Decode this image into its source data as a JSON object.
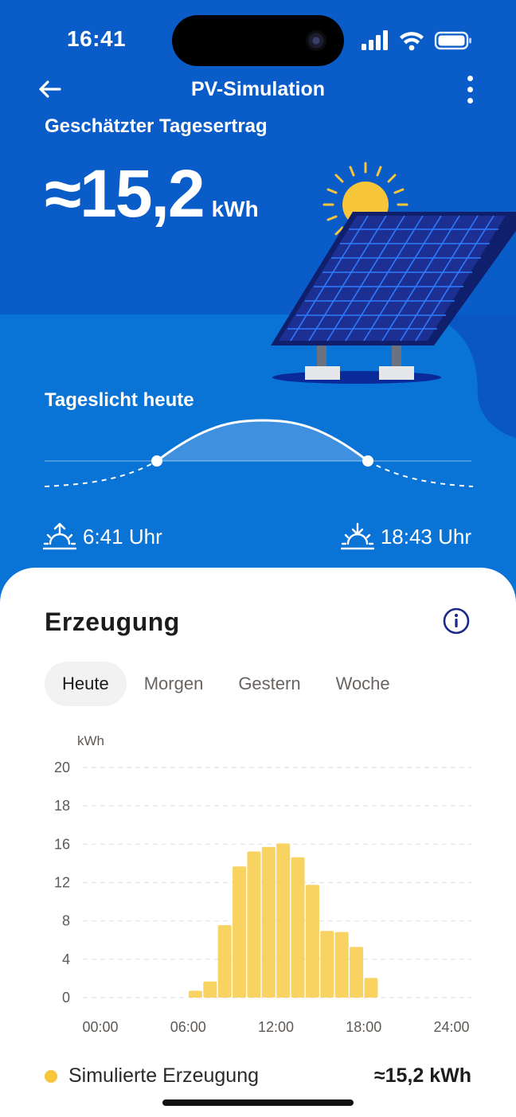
{
  "status_bar": {
    "time": "16:41"
  },
  "nav": {
    "title": "PV-Simulation",
    "back_icon": "arrow-left-icon",
    "menu_icon": "more-vertical-icon"
  },
  "hero": {
    "yield_label": "Geschätzter Tagesertrag",
    "yield_value": "≈15,2",
    "yield_unit": "kWh",
    "daylight_label": "Tageslicht heute",
    "sunrise": "6:41 Uhr",
    "sunset": "18:43 Uhr"
  },
  "sheet": {
    "title": "Erzeugung",
    "tabs": [
      {
        "label": "Heute",
        "active": true
      },
      {
        "label": "Morgen",
        "active": false
      },
      {
        "label": "Gestern",
        "active": false
      },
      {
        "label": "Woche",
        "active": false
      }
    ],
    "legend": {
      "label": "Simulierte Erzeugung",
      "value": "≈15,2 kWh"
    }
  },
  "colors": {
    "hero": "#0a5cc9",
    "bar": "#f9d361",
    "legend_dot": "#f7c63b",
    "info": "#1a2a8a"
  },
  "chart_data": {
    "type": "bar",
    "ylabel": "kWh",
    "ylim": [
      0,
      20
    ],
    "yticks": [
      "0",
      "4",
      "8",
      "12",
      "16",
      "18",
      "20"
    ],
    "xticks": [
      "00:00",
      "06:00",
      "12:00",
      "18:00",
      "24:00"
    ],
    "grid": true,
    "x": [
      6.5,
      7.5,
      8.5,
      9.5,
      10.5,
      11.5,
      12.5,
      13.5,
      14.5,
      15.5,
      16.5,
      17.5,
      18.5,
      19.5
    ],
    "values": [
      0.6,
      1.4,
      6.3,
      11.4,
      12.7,
      13.1,
      13.4,
      12.2,
      9.8,
      5.8,
      5.7,
      4.4,
      1.7,
      0
    ],
    "series": [
      {
        "name": "Simulierte Erzeugung"
      }
    ]
  }
}
